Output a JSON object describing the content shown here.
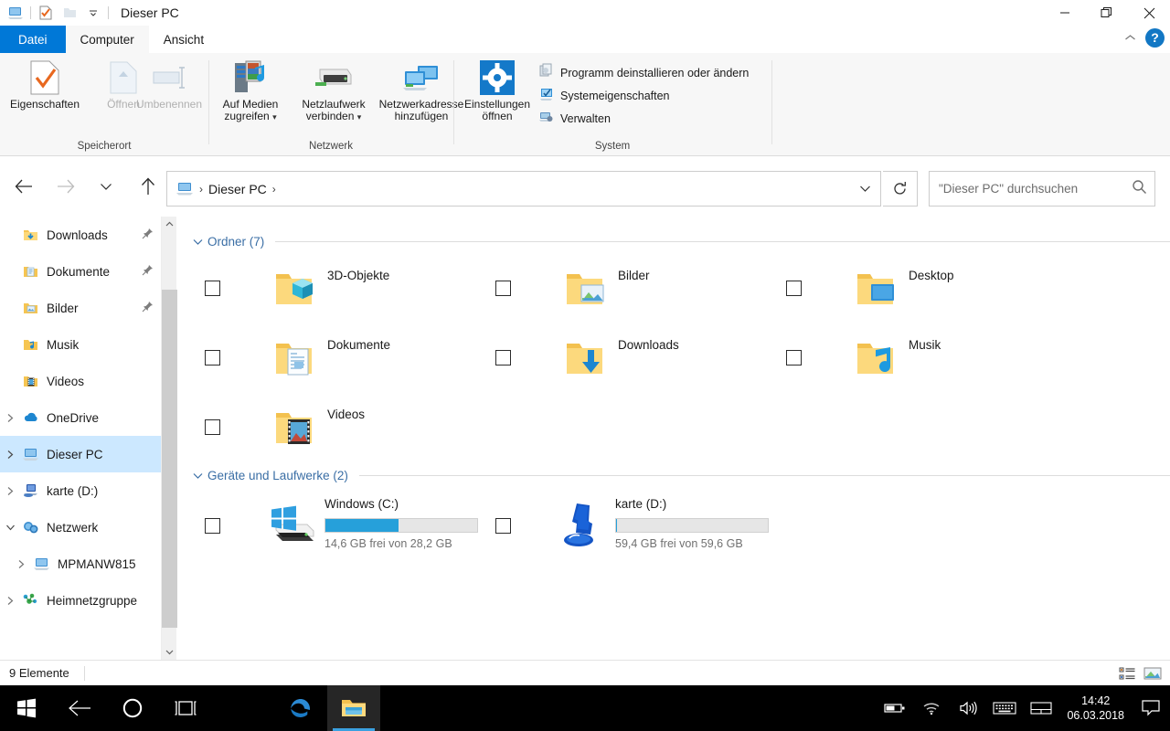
{
  "window": {
    "title": "Dieser PC",
    "quick_access": [
      "computer-icon",
      "properties-icon",
      "new-folder-icon",
      "customize-chevron"
    ],
    "controls": {
      "minimize": "minimize-icon",
      "maximize": "maximize-icon",
      "close": "close-icon"
    }
  },
  "ribbon": {
    "tabs": [
      {
        "label": "Datei",
        "kind": "file"
      },
      {
        "label": "Computer",
        "kind": "active"
      },
      {
        "label": "Ansicht",
        "kind": "normal"
      }
    ],
    "collapse_icon": "chevron-up-icon",
    "help_label": "?",
    "groups": [
      {
        "name": "Speicherort",
        "buttons": [
          {
            "label": "Eigenschaften",
            "icon": "properties-icon",
            "disabled": false
          },
          {
            "label": "Öffnen",
            "icon": "open-icon",
            "disabled": true
          },
          {
            "label": "Umbenennen",
            "icon": "rename-icon",
            "disabled": true
          }
        ]
      },
      {
        "name": "Netzwerk",
        "buttons": [
          {
            "label": "Auf Medien\nzugreifen",
            "line1": "Auf Medien",
            "line2": "zugreifen",
            "icon": "media-server-icon",
            "dropdown": true
          },
          {
            "label": "Netzlaufwerk\nverbinden",
            "line1": "Netzlaufwerk",
            "line2": "verbinden",
            "icon": "map-drive-icon",
            "dropdown": true
          },
          {
            "label": "Netzwerkadresse\nhinzufügen",
            "line1": "Netzwerkadresse",
            "line2": "hinzufügen",
            "icon": "add-network-location-icon",
            "dropdown": false
          }
        ]
      },
      {
        "name": "System",
        "big_button": {
          "line1": "Einstellungen",
          "line2": "öffnen",
          "icon": "settings-gear-icon"
        },
        "small_buttons": [
          {
            "label": "Programm deinstallieren oder ändern",
            "icon": "uninstall-program-icon"
          },
          {
            "label": "Systemeigenschaften",
            "icon": "system-properties-icon"
          },
          {
            "label": "Verwalten",
            "icon": "manage-icon"
          }
        ]
      }
    ]
  },
  "nav": {
    "back": "back-arrow-icon",
    "forward": "forward-arrow-icon",
    "recent": "chevron-down-icon",
    "up": "up-arrow-icon",
    "address": {
      "icon": "this-pc-icon",
      "crumbs": [
        "Dieser PC"
      ],
      "dropdown": "chevron-down-icon"
    },
    "refresh": "refresh-icon",
    "search": {
      "placeholder": "\"Dieser PC\" durchsuchen",
      "value": "",
      "icon": "search-icon"
    }
  },
  "sidebar": {
    "items": [
      {
        "label": "Downloads",
        "icon": "folder-downloads-icon",
        "chevron": "",
        "pinned": true,
        "indent": 1,
        "selected": false
      },
      {
        "label": "Dokumente",
        "icon": "folder-documents-icon",
        "chevron": "",
        "pinned": true,
        "indent": 1,
        "selected": false
      },
      {
        "label": "Bilder",
        "icon": "folder-pictures-icon",
        "chevron": "",
        "pinned": true,
        "indent": 1,
        "selected": false
      },
      {
        "label": "Musik",
        "icon": "folder-music-icon",
        "chevron": "",
        "pinned": false,
        "indent": 1,
        "selected": false
      },
      {
        "label": "Videos",
        "icon": "folder-videos-icon",
        "chevron": "",
        "pinned": false,
        "indent": 1,
        "selected": false
      },
      {
        "label": "OneDrive",
        "icon": "onedrive-icon",
        "chevron": "right",
        "pinned": false,
        "indent": 0,
        "selected": false
      },
      {
        "label": "Dieser PC",
        "icon": "this-pc-icon",
        "chevron": "right",
        "pinned": false,
        "indent": 0,
        "selected": true
      },
      {
        "label": "karte (D:)",
        "icon": "network-drive-icon",
        "chevron": "right",
        "pinned": false,
        "indent": 0,
        "selected": false
      },
      {
        "label": "Netzwerk",
        "icon": "network-icon",
        "chevron": "down",
        "pinned": false,
        "indent": 0,
        "selected": false
      },
      {
        "label": "MPMANW815",
        "icon": "computer-icon",
        "chevron": "right",
        "pinned": false,
        "indent": 1,
        "selected": false
      },
      {
        "label": "Heimnetzgruppe",
        "icon": "homegroup-icon",
        "chevron": "right",
        "pinned": false,
        "indent": 0,
        "selected": false
      }
    ],
    "scrollbar": {
      "up": "scroll-up-icon",
      "down": "scroll-down-icon"
    }
  },
  "content": {
    "folders_group": {
      "title": "Ordner (7)",
      "chevron": "chevron-down-icon"
    },
    "folders": [
      {
        "name": "3D-Objekte",
        "icon": "folder-3d-objects-icon"
      },
      {
        "name": "Bilder",
        "icon": "folder-pictures-icon"
      },
      {
        "name": "Desktop",
        "icon": "folder-desktop-icon"
      },
      {
        "name": "Dokumente",
        "icon": "folder-documents-icon"
      },
      {
        "name": "Downloads",
        "icon": "folder-downloads-icon"
      },
      {
        "name": "Musik",
        "icon": "folder-music-icon"
      },
      {
        "name": "Videos",
        "icon": "folder-videos-icon"
      }
    ],
    "drives_group": {
      "title": "Geräte und Laufwerke (2)",
      "chevron": "chevron-down-icon"
    },
    "drives": [
      {
        "name": "Windows (C:)",
        "icon": "windows-drive-icon",
        "free_text": "14,6 GB frei von 28,2 GB",
        "free_gb": 14.6,
        "total_gb": 28.2,
        "used_percent": 48,
        "bar_color": "#26a0da"
      },
      {
        "name": "karte (D:)",
        "icon": "network-map-drive-icon",
        "free_text": "59,4 GB frei von 59,6 GB",
        "free_gb": 59.4,
        "total_gb": 59.6,
        "used_percent": 0,
        "bar_color": "#26a0da"
      }
    ]
  },
  "statusbar": {
    "item_count": "9 Elemente",
    "views": [
      {
        "name": "details-view-button",
        "selected": false
      },
      {
        "name": "large-icons-view-button",
        "selected": true
      }
    ]
  },
  "taskbar": {
    "start": "windows-start-icon",
    "back": "back-arrow-icon",
    "cortana": "cortana-circle-icon",
    "taskview": "task-view-icon",
    "apps": [
      {
        "name": "edge-browser",
        "icon": "edge-icon",
        "active": false
      },
      {
        "name": "file-explorer",
        "icon": "file-explorer-icon",
        "active": true
      }
    ],
    "tray": [
      "battery-icon",
      "wifi-icon",
      "volume-icon",
      "keyboard-icon",
      "touchpad-icon"
    ],
    "clock": {
      "time": "14:42",
      "date": "06.03.2018"
    },
    "action_center": "action-center-icon"
  },
  "colors": {
    "accent": "#0078d7",
    "selection": "#cce8ff",
    "group_header": "#3a6ea5",
    "drive_bar": "#26a0da",
    "taskbar_bg": "#000000"
  }
}
